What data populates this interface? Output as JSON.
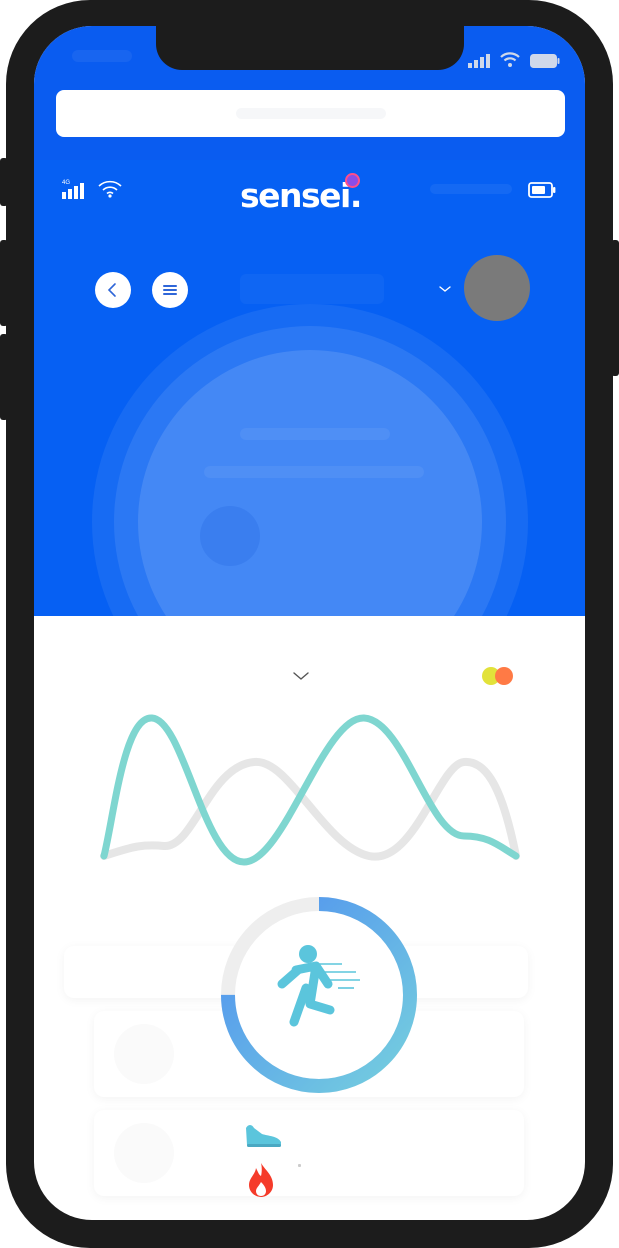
{
  "app": {
    "name": "sensei",
    "logo_text": "sensei"
  },
  "colors": {
    "os_bar": "#0a5cf0",
    "header": "#0660f3",
    "wave_primary": "#7fd6d0",
    "wave_secondary": "#e6e6e6",
    "ring_start": "#76d0de",
    "ring_end": "#4f8ff0",
    "logo_dot": "#e8407a"
  },
  "icons": {
    "back": "chevron-left-icon",
    "menu": "hamburger-menu-icon",
    "dropdown": "chevron-down-icon",
    "activity": "running-person-icon",
    "steps": "sneaker-icon",
    "calories": "flame-icon",
    "signal": "cellular-signal-icon",
    "wifi": "wifi-icon",
    "battery": "battery-icon"
  },
  "activity_progress": 0.75
}
